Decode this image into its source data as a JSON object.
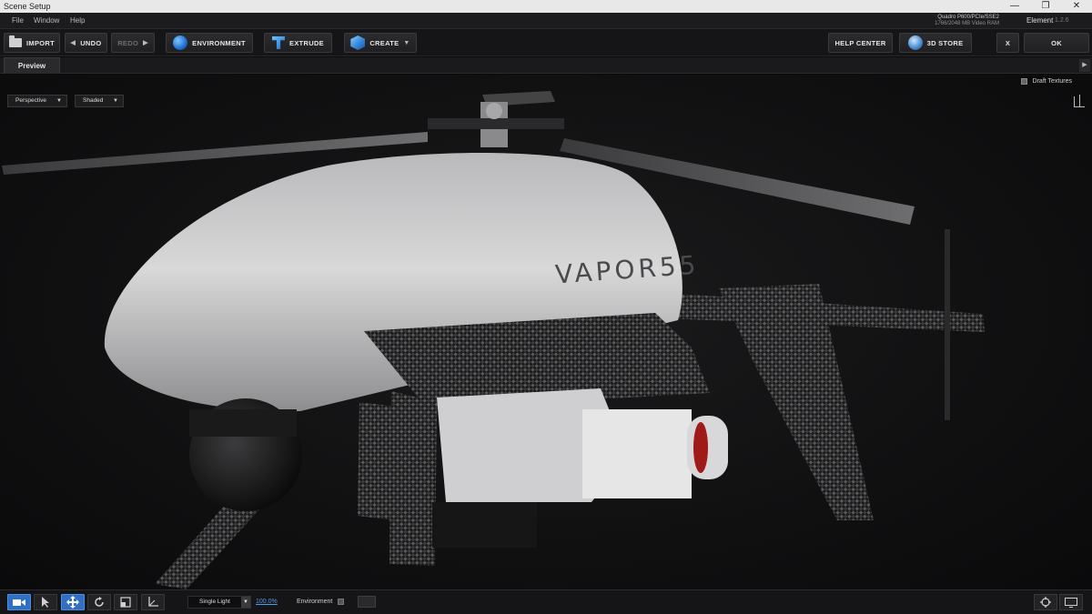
{
  "window": {
    "title": "Scene Setup",
    "controls": [
      "—",
      "❐",
      "✕"
    ]
  },
  "menu": {
    "items": [
      "File",
      "Window",
      "Help"
    ]
  },
  "system_info": {
    "gpu": "Quadro P600/PCIe/SSE2",
    "vram": "1766/2048 MB Video RAM",
    "app_name": "Element",
    "app_version": "1.2.6"
  },
  "toolbar": {
    "import": "IMPORT",
    "undo": "UNDO",
    "redo": "REDO",
    "environment": "ENVIRONMENT",
    "extrude": "EXTRUDE",
    "create": "CREATE",
    "help_center": "HELP CENTER",
    "store": "3D STORE",
    "close": "X",
    "ok": "OK"
  },
  "preview": {
    "tab": "Preview",
    "camera_select": "Perspective",
    "shading_select": "Shaded",
    "draft_textures": "Draft Textures",
    "model_text": "VAPOR55"
  },
  "bottom": {
    "tools": [
      "camera-icon",
      "pointer-icon",
      "move-icon",
      "rotate-icon",
      "scale-icon",
      "axis-icon"
    ],
    "active_tool": "move-icon",
    "light_select": "Single Light",
    "intensity": "100.0%",
    "environment_label": "Environment"
  },
  "colors": {
    "accent": "#2f6fc4",
    "link": "#4b9bea"
  }
}
